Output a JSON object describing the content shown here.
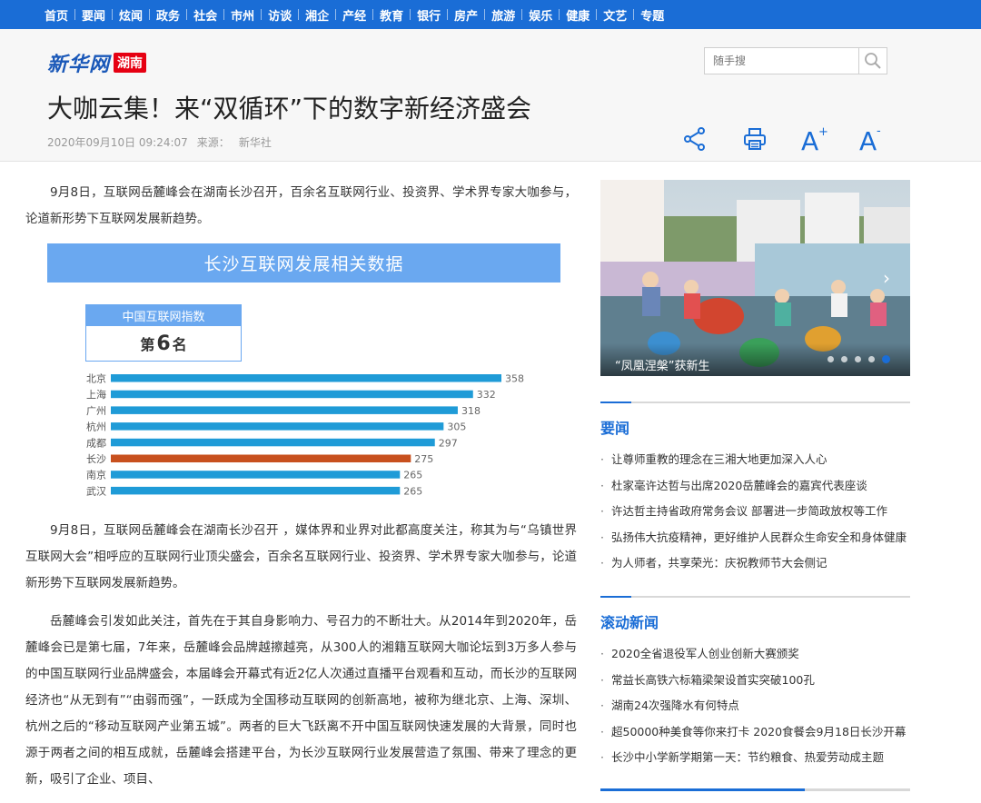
{
  "nav": [
    "首页",
    "要闻",
    "炫闻",
    "政务",
    "社会",
    "市州",
    "访谈",
    "湘企",
    "产经",
    "教育",
    "银行",
    "房产",
    "旅游",
    "娱乐",
    "健康",
    "文艺",
    "专题"
  ],
  "logo": {
    "brand": "新华网",
    "region": "湖南"
  },
  "search": {
    "placeholder": "随手搜"
  },
  "article": {
    "title": "大咖云集！来“双循环”下的数字新经济盛会",
    "datetime": "2020年09月10日 09:24:07",
    "source_label": "来源：",
    "source": "新华社",
    "p1": "9月8日，互联网岳麓峰会在湖南长沙召开，百余名互联网行业、投资界、学术界专家大咖参与，论道新形势下互联网发展新趋势。",
    "p2": "9月8日，互联网岳麓峰会在湖南长沙召开 ，媒体界和业界对此都高度关注，称其为与“乌镇世界互联网大会”相呼应的互联网行业顶尖盛会，百余名互联网行业、投资界、学术界专家大咖参与，论道新形势下互联网发展新趋势。",
    "p3": "岳麓峰会引发如此关注，首先在于其自身影响力、号召力的不断壮大。从2014年到2020年，岳麓峰会已是第七届，7年来，岳麓峰会品牌越擦越亮，从300人的湘籍互联网大咖论坛到3万多人参与的中国互联网行业品牌盛会，本届峰会开幕式有近2亿人次通过直播平台观看和互动，而长沙的互联网经济也“从无到有”“由弱而强”，一跃成为全国移动互联网的创新高地，被称为继北京、上海、深圳、杭州之后的“移动互联网产业第五城”。两者的巨大飞跃离不开中国互联网快速发展的大背景，同时也源于两者之间的相互成就，岳麓峰会搭建平台，为长沙互联网行业发展营造了氛围、带来了理念的更新，吸引了企业、项目、"
  },
  "figure": {
    "banner": "长沙互联网发展相关数据",
    "index_label": "中国互联网指数",
    "rank_prefix": "第",
    "rank_num": "6",
    "rank_suffix": "名"
  },
  "chart_data": {
    "type": "bar",
    "orientation": "horizontal",
    "title": "",
    "categories": [
      "北京",
      "上海",
      "广州",
      "杭州",
      "成都",
      "长沙",
      "南京",
      "武汉"
    ],
    "values": [
      358,
      332,
      318,
      305,
      297,
      275,
      265,
      265
    ],
    "highlight": "长沙",
    "colors": {
      "default": "#1f9bd7",
      "highlight": "#c8501e"
    },
    "xlim": [
      0,
      358
    ],
    "grid": false
  },
  "slider": {
    "caption": "“凤凰涅槃”获新生",
    "slides": 5,
    "active": 5
  },
  "sections": [
    {
      "title": "要闻",
      "items": [
        "让尊师重教的理念在三湘大地更加深入人心",
        "杜家毫许达哲与出席2020岳麓峰会的嘉宾代表座谈",
        "许达哲主持省政府常务会议 部署进一步简政放权等工作",
        "弘扬伟大抗疫精神，更好维护人民群众生命安全和身体健康",
        "为人师者，共享荣光：庆祝教师节大会侧记"
      ]
    },
    {
      "title": "滚动新闻",
      "items": [
        "2020全省退役军人创业创新大赛颁奖",
        "常益长高铁六标箱梁架设首实突破100孔",
        "湖南24次强降水有何特点",
        "超50000种美食等你来打卡 2020食餐会9月18日长沙开幕",
        "长沙中小学新学期第一天：节约粮食、热爱劳动成主题"
      ]
    }
  ],
  "colors": {
    "nav_bg": "#1a6dd6",
    "accent": "#1a6dd6",
    "logo_red": "#e60012"
  }
}
